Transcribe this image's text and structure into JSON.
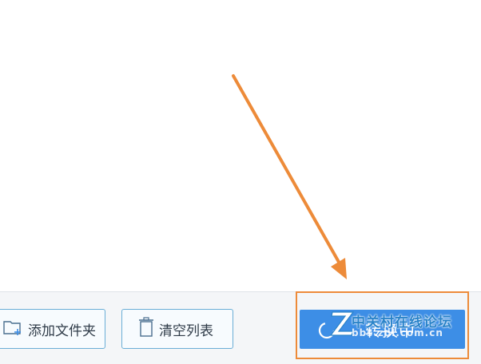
{
  "footer": {
    "add_folder_label": "添加文件夹",
    "clear_list_label": "清空列表",
    "convert_label": "转换中"
  },
  "watermark": {
    "site_name": "中关村在线论坛",
    "url": "bbs.zol.com.cn"
  },
  "icons": {
    "add_folder": "folder-plus-icon",
    "clear_list": "trash-icon",
    "converting": "loading-spinner-icon"
  },
  "colors": {
    "accent_blue": "#3d8ee6",
    "annotation_orange": "#ed8b39",
    "button_border": "#6aaed6"
  }
}
